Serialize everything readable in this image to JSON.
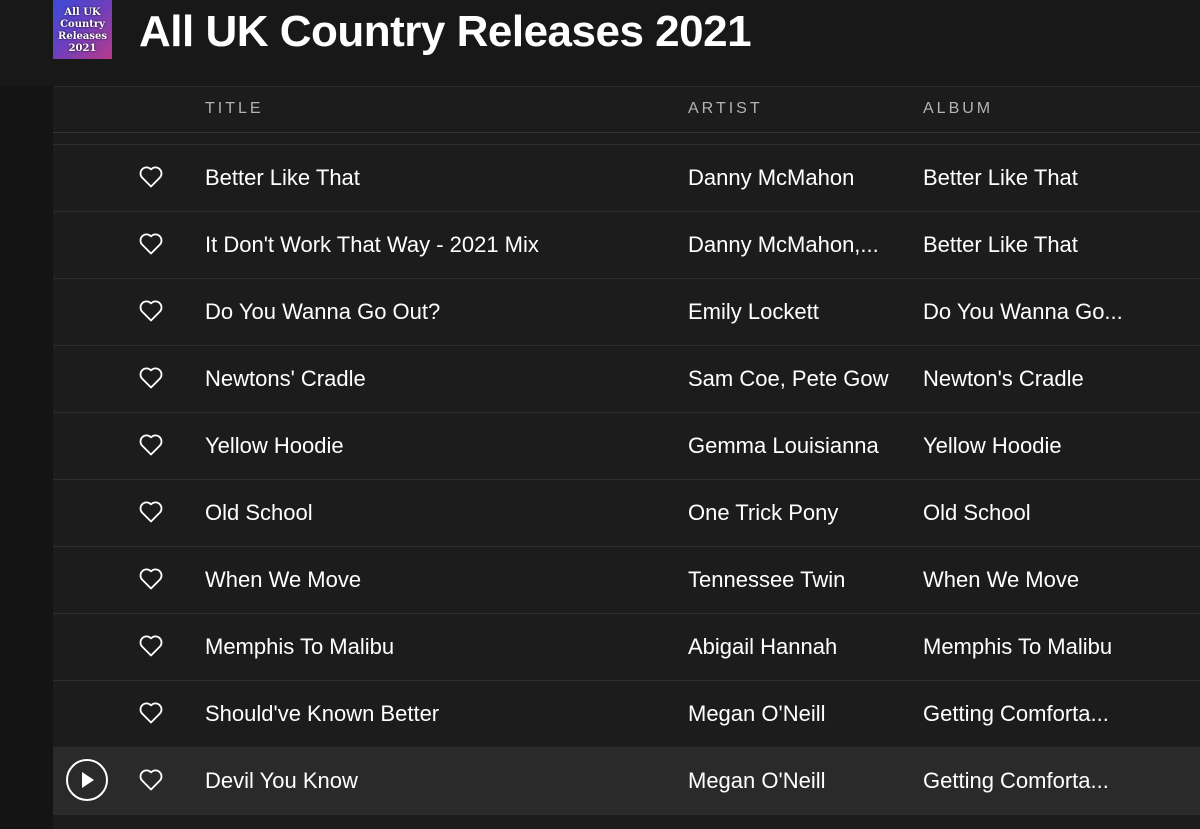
{
  "playlist": {
    "title": "All UK Country Releases 2021",
    "cover_lines": [
      "All UK",
      "Country",
      "Releases",
      "2021"
    ]
  },
  "columns": {
    "title": "TITLE",
    "artist": "ARTIST",
    "album": "ALBUM"
  },
  "tracks": [
    {
      "title": "Better Like That",
      "artist": "Danny McMahon",
      "album": "Better Like That"
    },
    {
      "title": "It Don't Work That Way - 2021 Mix",
      "artist": "Danny McMahon,...",
      "album": "Better Like That"
    },
    {
      "title": "Do You Wanna Go Out?",
      "artist": "Emily Lockett",
      "album": "Do You Wanna Go..."
    },
    {
      "title": "Newtons' Cradle",
      "artist": "Sam Coe, Pete Gow",
      "album": "Newton's Cradle"
    },
    {
      "title": "Yellow Hoodie",
      "artist": "Gemma Louisianna",
      "album": "Yellow Hoodie"
    },
    {
      "title": "Old School",
      "artist": "One Trick Pony",
      "album": "Old School"
    },
    {
      "title": "When We Move",
      "artist": "Tennessee Twin",
      "album": "When We Move"
    },
    {
      "title": "Memphis To Malibu",
      "artist": "Abigail Hannah",
      "album": "Memphis To Malibu"
    },
    {
      "title": "Should've Known Better",
      "artist": "Megan O'Neill",
      "album": "Getting Comforta..."
    },
    {
      "title": "Devil You Know",
      "artist": "Megan O'Neill",
      "album": "Getting Comforta..."
    }
  ],
  "icons": {
    "heart": "heart-outline-icon",
    "play": "play-circle-icon"
  },
  "colors": {
    "background": "#121212",
    "row_background": "#1c1c1c",
    "active_row": "#2a2a2a",
    "header_text": "#b3b3b3",
    "text": "#ffffff"
  }
}
